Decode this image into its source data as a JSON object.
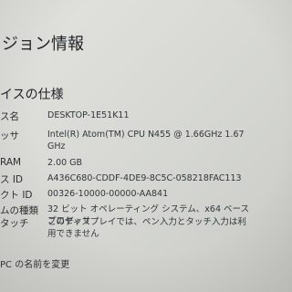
{
  "page": {
    "title": "ジョン情報"
  },
  "device_specs": {
    "heading": "イスの仕様",
    "rows": [
      {
        "label": "ス名",
        "value": "DESKTOP-1E51K11"
      },
      {
        "label": "ッサ",
        "value": "Intel(R) Atom(TM) CPU N455  @ 1.66GHz   1.67 GHz"
      },
      {
        "label": "RAM",
        "value": "2.00 GB"
      },
      {
        "label": "ス ID",
        "value": "A436C680-CDDF-4DE9-8C5C-058218FAC113"
      },
      {
        "label": "クト ID",
        "value": "00326-10000-00000-AA841"
      },
      {
        "label": "ムの種類",
        "value": "32 ビット オペレーティング システム、x64 ベース プロセッサ"
      },
      {
        "label": "タッチ",
        "value": "このディスプレイでは、ペン入力とタッチ入力は利用できません"
      }
    ]
  },
  "actions": {
    "rename": "PC の名前を変更"
  }
}
